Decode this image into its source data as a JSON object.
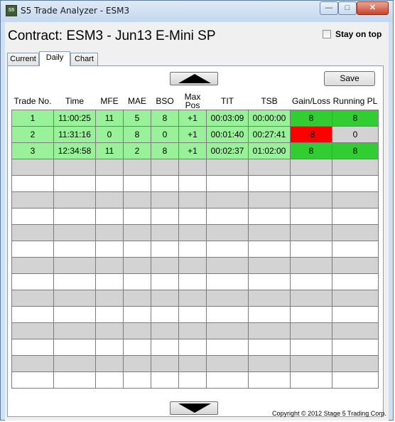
{
  "window": {
    "icon_text": "S5",
    "title": "S5 Trade Analyzer - ESM3",
    "buttons": {
      "minimize": "—",
      "maximize": "□",
      "close": "✕"
    }
  },
  "header": {
    "contract": "Contract: ESM3 - Jun13 E-Mini SP",
    "stay_on_top": "Stay on top",
    "stay_on_top_checked": false
  },
  "tabs": [
    {
      "label": "Current",
      "active": false
    },
    {
      "label": "Daily",
      "active": true
    },
    {
      "label": "Chart",
      "active": false
    }
  ],
  "toolbar": {
    "save_label": "Save"
  },
  "table": {
    "columns": [
      "Trade No.",
      "Time",
      "MFE",
      "MAE",
      "BSO",
      "Max\nPos",
      "TIT",
      "TSB",
      "Gain/Loss",
      "Running PL"
    ],
    "rows": [
      [
        "1",
        "11:00:25",
        "11",
        "5",
        "8",
        "+1",
        "00:03:09",
        "00:00:00",
        "8",
        "8"
      ],
      [
        "2",
        "11:31:16",
        "0",
        "8",
        "0",
        "+1",
        "00:01:40",
        "00:27:41",
        "-8",
        "0"
      ],
      [
        "3",
        "12:34:58",
        "11",
        "2",
        "8",
        "+1",
        "00:02:37",
        "01:02:00",
        "8",
        "8"
      ]
    ],
    "empty_rows": 14
  },
  "colors": {
    "row_fill": "#99f199",
    "gain_positive": "#32cd32",
    "gain_negative": "#ff0000",
    "running_zero": "#d3d3d3",
    "stripe_gray": "#d3d3d3"
  },
  "footer": {
    "copyright": "Copyright © 2012 Stage 5 Trading Corp."
  }
}
